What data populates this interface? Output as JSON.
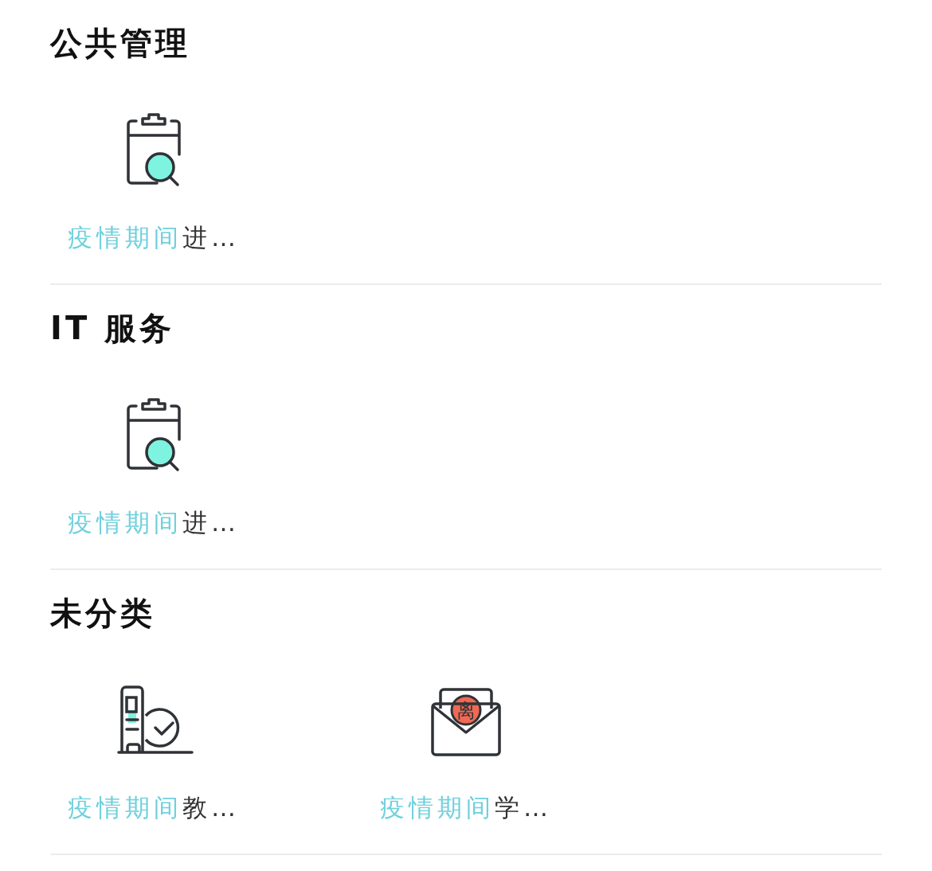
{
  "sections": [
    {
      "title": "公共管理",
      "apps": [
        {
          "kind": "clipboard",
          "highlight": "疫情期间",
          "rest": "进…"
        }
      ]
    },
    {
      "title": "IT 服务",
      "apps": [
        {
          "kind": "clipboard",
          "highlight": "疫情期间",
          "rest": "进…"
        }
      ]
    },
    {
      "title": "未分类",
      "apps": [
        {
          "kind": "kiosk",
          "highlight": "疫情期间",
          "rest": "教…"
        },
        {
          "kind": "envelope",
          "icon_text": "离",
          "highlight": "疫情期间",
          "rest": "学…"
        }
      ]
    }
  ]
}
